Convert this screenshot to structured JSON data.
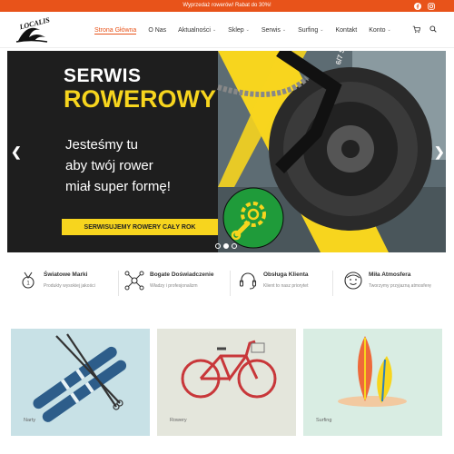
{
  "topbar": {
    "promo": "Wyprzedaż rowerów! Rabat do 30%!",
    "social": [
      "facebook-icon",
      "instagram-icon"
    ]
  },
  "header": {
    "logo_text": "LOCALIS",
    "nav": [
      {
        "label": "Strona Główna",
        "active": true,
        "dropdown": false
      },
      {
        "label": "O Nas",
        "active": false,
        "dropdown": false
      },
      {
        "label": "Aktualności",
        "active": false,
        "dropdown": true
      },
      {
        "label": "Sklep",
        "active": false,
        "dropdown": true
      },
      {
        "label": "Serwis",
        "active": false,
        "dropdown": true
      },
      {
        "label": "Surfing",
        "active": false,
        "dropdown": true
      },
      {
        "label": "Kontakt",
        "active": false,
        "dropdown": false
      },
      {
        "label": "Konto",
        "active": false,
        "dropdown": true
      }
    ],
    "icons": [
      "cart-icon",
      "search-icon"
    ]
  },
  "hero": {
    "title1": "SERWIS",
    "title2": "ROWEROWY",
    "subtitle_lines": [
      "Jesteśmy tu",
      "aby twój rower",
      "miał super formę!"
    ],
    "cta": "SERWISUJEMY ROWERY CAŁY ROK",
    "cassette_label": "6/7 SPEED",
    "slides": 3,
    "active_slide": 2
  },
  "features": [
    {
      "title": "Światowe Marki",
      "subtitle": "Produkty wysokiej jakości",
      "icon": "medal-icon"
    },
    {
      "title": "Bogate Doświadczenie",
      "subtitle": "Władzy i profesjonalizm",
      "icon": "network-icon"
    },
    {
      "title": "Obsługa Klienta",
      "subtitle": "Klient to nasz priorytet",
      "icon": "headset-icon"
    },
    {
      "title": "Miła Atmosfera",
      "subtitle": "Tworzymy przyjazną atmosferę",
      "icon": "smile-face-icon"
    }
  ],
  "categories": [
    {
      "label": "Narty",
      "bg": "#c8e1e6"
    },
    {
      "label": "Rowery",
      "bg": "#e4e6dc"
    },
    {
      "label": "Surfing",
      "bg": "#d9ede3"
    }
  ],
  "colors": {
    "accent": "#e8531a",
    "hero_yellow": "#f7d51e",
    "hero_green": "#1f9b3a",
    "hero_dark": "#1e1e1e"
  }
}
